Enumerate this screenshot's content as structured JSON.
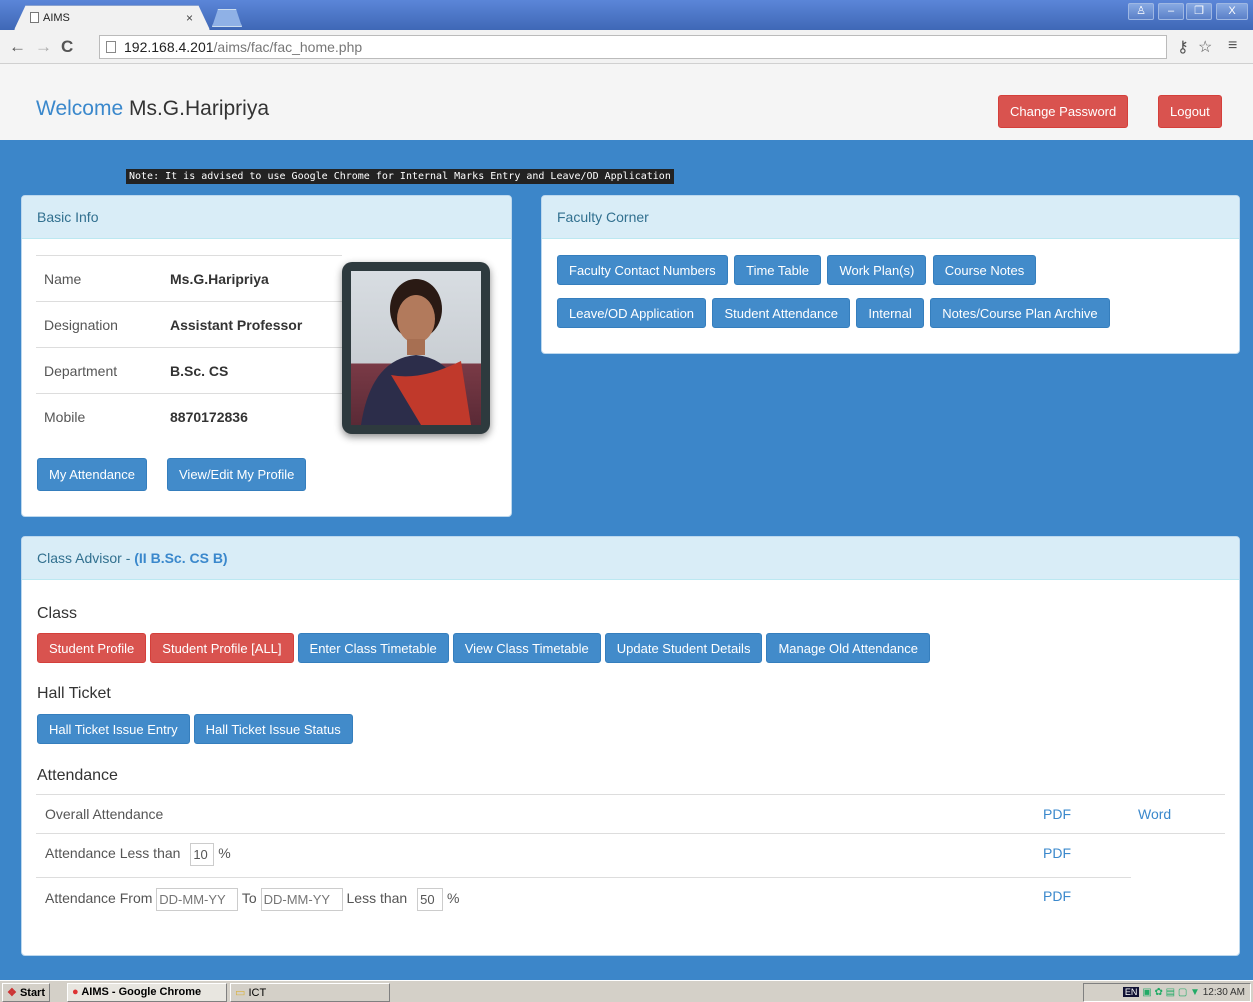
{
  "browser": {
    "tab_title": "AIMS",
    "tab_close": "×",
    "url_host": "192.168.4.201",
    "url_path": "/aims/fac/fac_home.php",
    "back": "←",
    "forward": "→",
    "reload": "C",
    "key_icon": "⚷",
    "star_icon": "☆",
    "menu_icon": "≡",
    "win_user": "♙",
    "win_min": "–",
    "win_max": "❐",
    "win_close": "X"
  },
  "header": {
    "welcome": "Welcome",
    "user_name": "Ms.G.Haripriya",
    "change_password": "Change Password",
    "logout": "Logout"
  },
  "note": "Note: It is advised to use Google Chrome for Internal Marks Entry and Leave/OD Application",
  "basic_info": {
    "heading": "Basic Info",
    "rows": [
      {
        "label": "Name",
        "value": "Ms.G.Haripriya"
      },
      {
        "label": "Designation",
        "value": "Assistant Professor"
      },
      {
        "label": "Department",
        "value": "B.Sc. CS"
      },
      {
        "label": "Mobile",
        "value": "8870172836"
      }
    ],
    "my_attendance": "My Attendance",
    "edit_profile": "View/Edit My Profile"
  },
  "faculty_corner": {
    "heading": "Faculty Corner",
    "row1": [
      "Faculty Contact Numbers",
      "Time Table",
      "Work Plan(s)",
      "Course Notes"
    ],
    "row2": [
      "Leave/OD Application",
      "Student Attendance",
      "Internal",
      "Notes/Course Plan Archive"
    ]
  },
  "class_advisor": {
    "heading": "Class Advisor - ",
    "class_name": "(II B.Sc. CS B)",
    "class_section": "Class",
    "class_buttons": [
      "Student Profile",
      "Student Profile [ALL]",
      "Enter Class Timetable",
      "View Class Timetable",
      "Update Student Details",
      "Manage Old Attendance"
    ],
    "hall_ticket_section": "Hall Ticket",
    "hall_ticket_buttons": [
      "Hall Ticket Issue Entry",
      "Hall Ticket Issue Status"
    ],
    "attendance_section": "Attendance",
    "overall": "Overall Attendance",
    "pdf": "PDF",
    "word": "Word",
    "less_than_label": "Attendance Less than",
    "less_than_value": "10",
    "percent": "%",
    "from_label": "Attendance From",
    "date_placeholder": "DD-MM-YY",
    "to_label": "To",
    "less_than_short": "Less than",
    "range_value": "50"
  },
  "taskbar": {
    "start": "Start",
    "chrome_item": "AIMS - Google Chrome",
    "folder_item": "ICT",
    "lang": "EN",
    "clock": "12:30 AM"
  }
}
